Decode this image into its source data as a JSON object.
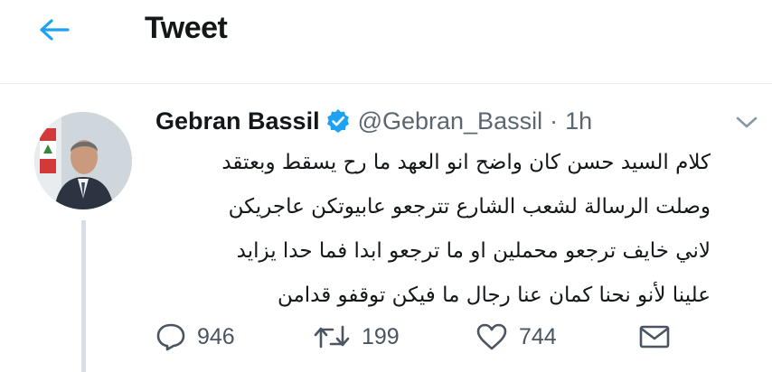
{
  "header": {
    "title": "Tweet",
    "back_icon": "arrow-left-icon",
    "accent_color": "#1da1f2"
  },
  "tweet": {
    "author_name": "Gebran Bassil",
    "handle": "@Gebran_Bassil",
    "separator": "·",
    "time": "1h",
    "verified": true,
    "verified_color": "#1da1f2",
    "avatar_icon": "avatar-photo",
    "menu_icon": "chevron-down-icon",
    "text_lines": [
      "كلام السيد حسن كان واضح انو العهد ما رح يسقط وبعتقد",
      "وصلت الرسالة لشعب الشارع تترجعو عابيوتكن عاجريكن",
      "لاني خايف ترجعو محملين او ما ترجعو ابدا فما حدا يزايد",
      "علينا لأنو نحنا كمان عنا رجال ما فيكن توقفو قدامن"
    ]
  },
  "actions": {
    "reply_count": "946",
    "retweet_count": "199",
    "like_count": "744",
    "reply_icon": "reply-icon",
    "retweet_icon": "retweet-icon",
    "like_icon": "heart-icon",
    "share_icon": "envelope-icon"
  }
}
